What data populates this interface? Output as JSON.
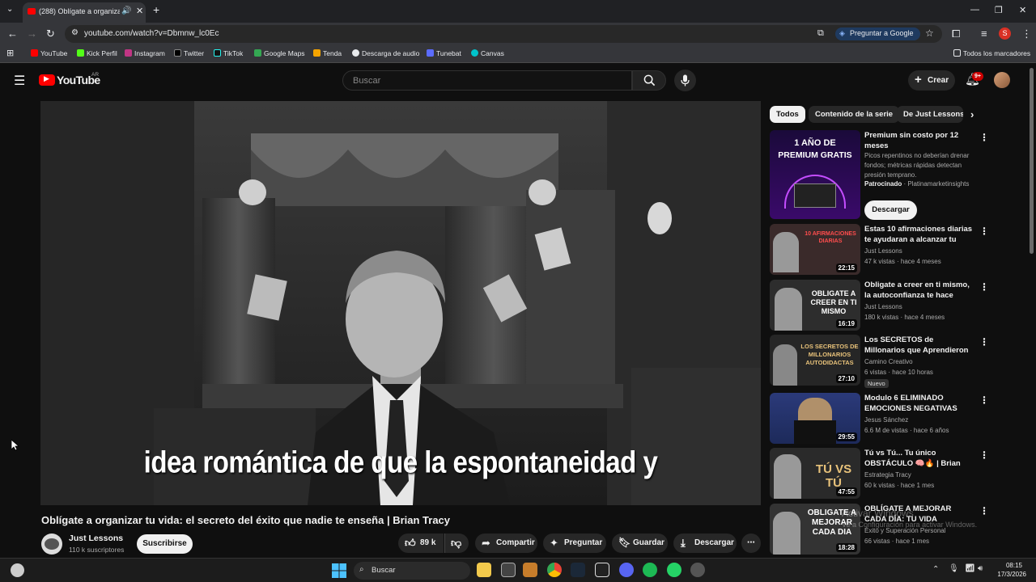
{
  "browser": {
    "tab_title": "(288) Oblígate a organizar tu vida: el secreto del éxito que nadie te enseña | Brian Tracy",
    "url": "youtube.com/watch?v=Dbmnw_lc0Ec",
    "ask_google": "Preguntar a Google",
    "bookmarks": [
      "YouTube",
      "Kick Perfil",
      "Instagram",
      "Twitter",
      "TikTok",
      "Google Maps",
      "Tenda",
      "Descarga de audio",
      "Tunebat",
      "Canvas"
    ],
    "all_bookmarks": "Todos los marcadores",
    "profile_initial": "S"
  },
  "header": {
    "logo_text": "YouTube",
    "region": "AR",
    "search_placeholder": "Buscar",
    "create_label": "Crear",
    "notif_count": "9+"
  },
  "video": {
    "subtitle": "idea romántica de que la espontaneidad y",
    "title": "Oblígate a organizar tu vida: el secreto del éxito que nadie te enseña | Brian Tracy",
    "channel": "Just Lessons",
    "subscribers": "110 k suscriptores",
    "subscribe_label": "Suscribirse",
    "likes": "89 k",
    "share_label": "Compartir",
    "ask_label": "Preguntar",
    "save_label": "Guardar",
    "download_label": "Descargar"
  },
  "chips": [
    "Todos",
    "Contenido de la serie",
    "De Just Lessons"
  ],
  "ad": {
    "thumb_line1": "1 AÑO DE",
    "thumb_line2": "PREMIUM GRATIS",
    "title": "Premium sin costo por 12 meses",
    "description": "Picos repentinos no deberían drenar fondos; métricas rápidas detectan presión temprano.",
    "sponsor_label": "Patrocinado",
    "sponsor": "Platinamarketinsights",
    "cta": "Descargar"
  },
  "recommendations": [
    {
      "title": "Estas 10 afirmaciones diarias te ayudaran a alcanzar tu mejor ...",
      "channel": "Just Lessons",
      "meta": "47 k vistas · hace 4 meses",
      "duration": "22:15",
      "thumb_text": "10 AFIRMACIONES DIARIAS",
      "thumb_color": "#3a2a2a",
      "badge": ""
    },
    {
      "title": "Obligate a creer en ti mismo, la autoconfianza te hace alguien ...",
      "channel": "Just Lessons",
      "meta": "180 k vistas · hace 4 meses",
      "duration": "16:19",
      "thumb_text": "OBLIGATE A CREER EN TI MISMO",
      "thumb_color": "#2d2d2d",
      "badge": ""
    },
    {
      "title": "Los SECRETOS de Millonarios que Aprendieron por su Cuent...",
      "channel": "Camino Creativo",
      "meta": "6 vistas · hace 10 horas",
      "duration": "27:10",
      "thumb_text": "LOS SECRETOS DE MILLONARIOS AUTODIDACTAS",
      "thumb_color": "#262626",
      "badge": "Nuevo"
    },
    {
      "title": "Modulo 6 ELIMINADO EMOCIONES NEGATIVAS",
      "channel": "Jesus Sánchez",
      "meta": "6.6 M de vistas · hace 6 años",
      "duration": "29:55",
      "thumb_text": "",
      "thumb_color": "#1d2a5a",
      "badge": ""
    },
    {
      "title": "Tú vs Tú... Tu único OBSTÁCULO 🧠🔥 | Brian Tracy",
      "channel": "Estrategia Tracy",
      "meta": "60 k vistas · hace 1 mes",
      "duration": "47:55",
      "thumb_text": "TÚ VS TÚ",
      "thumb_color": "#2a2a2a",
      "badge": ""
    },
    {
      "title": "OBLÍGATE A MEJORAR CADA DÍA: TU VIDA CAMBIARÁ MÁS...",
      "channel": "Éxito y Superación Personal",
      "meta": "66 vistas · hace 1 mes",
      "duration": "18:28",
      "thumb_text": "OBLIGATE A MEJORAR CADA DIA",
      "thumb_color": "#333",
      "badge": ""
    }
  ],
  "watermark": {
    "line1": "Activar Windows",
    "line2": "Ve a Configuración para activar Windows."
  },
  "taskbar": {
    "search": "Buscar",
    "time": "08:15",
    "date": "17/3/2026"
  }
}
